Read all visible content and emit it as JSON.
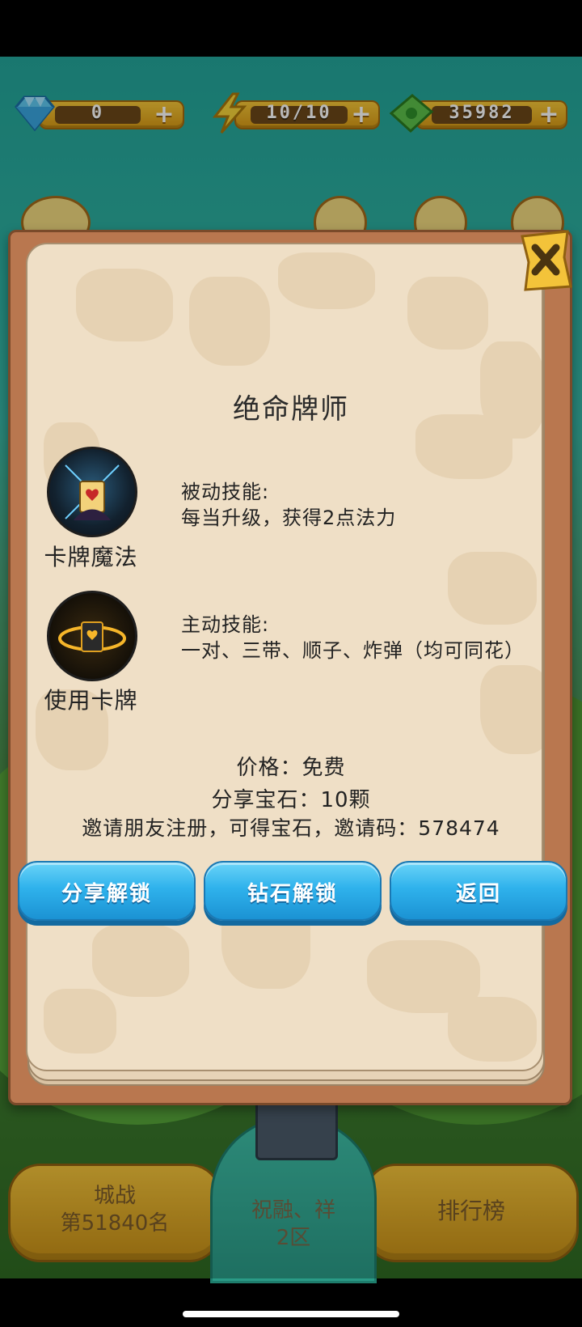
{
  "resources": {
    "gems": "0",
    "energy": "10/10",
    "cash": "35982"
  },
  "modal": {
    "title": "绝命牌师",
    "skills": [
      {
        "name": "卡牌魔法",
        "type_label": "被动技能:",
        "description": "每当升级，获得2点法力"
      },
      {
        "name": "使用卡牌",
        "type_label": "主动技能:",
        "description": "一对、三带、顺子、炸弹（均可同花）"
      }
    ],
    "price": "价格：免费",
    "share_gems": "分享宝石：10颗",
    "invite": "邀请朋友注册，可得宝石，邀请码：578474",
    "buttons": {
      "share_unlock": "分享解锁",
      "diamond_unlock": "钻石解锁",
      "back": "返回"
    }
  },
  "bottom_nav": {
    "city_war_title": "城战",
    "city_war_rank": "第51840名",
    "server_name": "祝融、祥",
    "server_zone": "2区",
    "leaderboard": "排行榜"
  },
  "colors": {
    "button_blue": "#2fb2ec",
    "gold": "#f3c33a",
    "paper": "#efdfc6",
    "frame": "#b9774f"
  }
}
